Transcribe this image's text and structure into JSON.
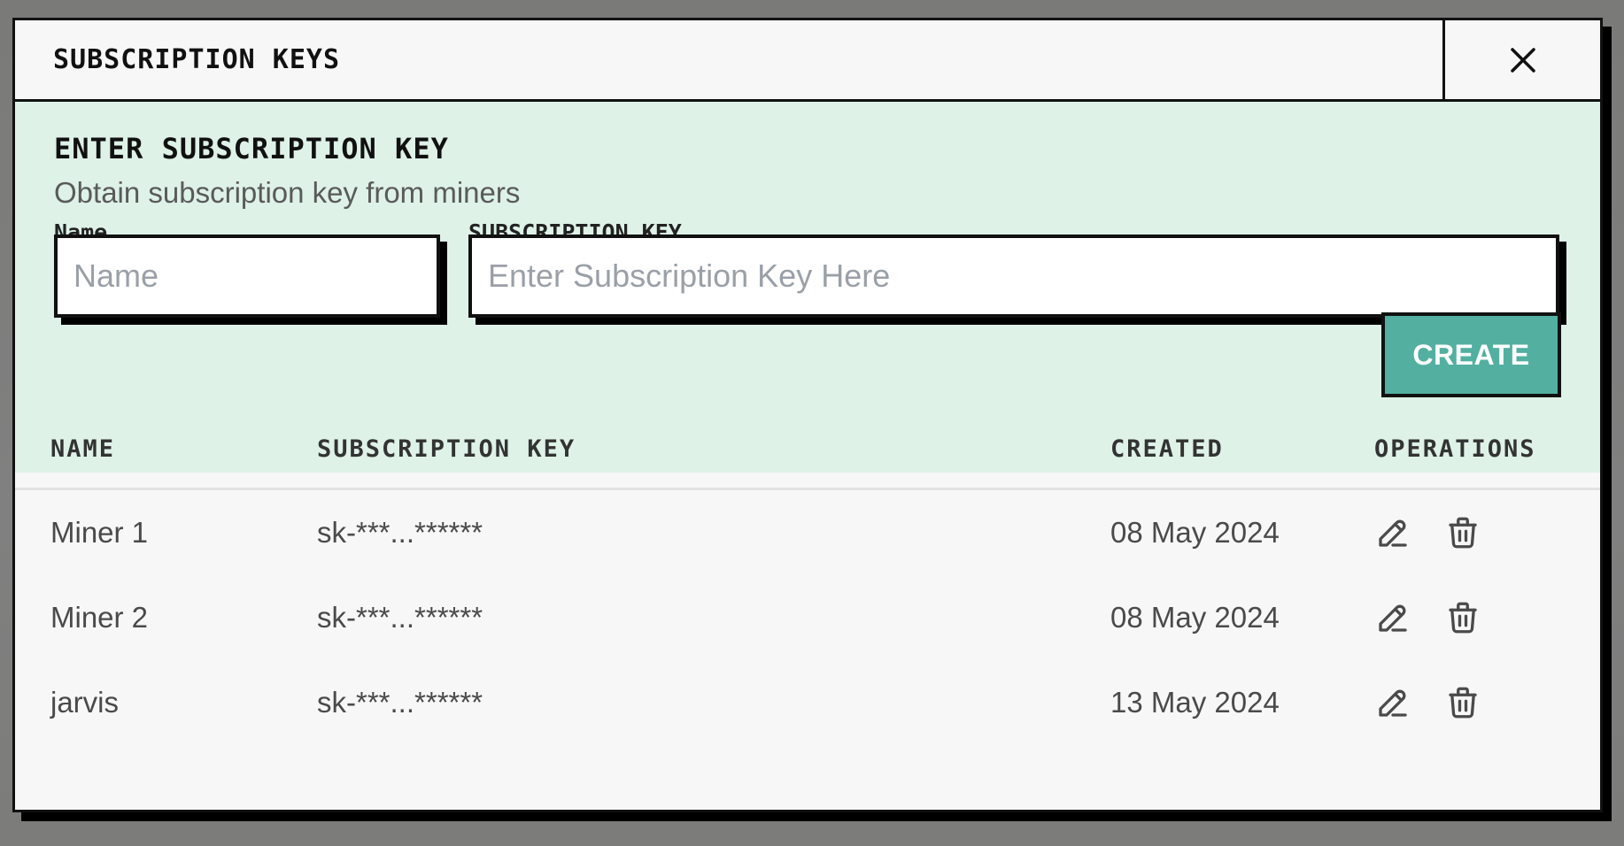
{
  "modal": {
    "title": "SUBSCRIPTION KEYS",
    "close_icon": "close-icon"
  },
  "form": {
    "section_title": "ENTER SUBSCRIPTION KEY",
    "section_subtitle": "Obtain subscription key from miners",
    "name_label": "Name",
    "name_placeholder": "Name",
    "name_value": "",
    "key_label": "SUBSCRIPTION KEY",
    "key_placeholder": "Enter Subscription Key Here",
    "key_value": "",
    "create_label": "CREATE"
  },
  "table": {
    "headers": [
      "NAME",
      "SUBSCRIPTION KEY",
      "CREATED",
      "OPERATIONS"
    ],
    "rows": [
      {
        "name": "Miner 1",
        "key": "sk-***...******",
        "created": "08 May 2024"
      },
      {
        "name": "Miner 2",
        "key": "sk-***...******",
        "created": "08 May 2024"
      },
      {
        "name": "jarvis",
        "key": "sk-***...******",
        "created": "13 May 2024"
      }
    ],
    "operation_icons": [
      "edit-icon",
      "trash-icon"
    ]
  },
  "colors": {
    "accent": "#53b0a1",
    "form_background": "#def2e7",
    "border": "#111111"
  }
}
